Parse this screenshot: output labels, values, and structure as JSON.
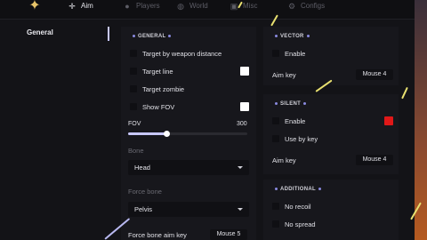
{
  "tabs": [
    {
      "label": "Aim",
      "icon": "crosshair-icon",
      "active": true
    },
    {
      "label": "Players",
      "icon": "user-icon",
      "active": false
    },
    {
      "label": "World",
      "icon": "globe-icon",
      "active": false
    },
    {
      "label": "Misc",
      "icon": "box-icon",
      "active": false
    },
    {
      "label": "Configs",
      "icon": "gear-icon",
      "active": false
    }
  ],
  "sidebar": {
    "items": [
      {
        "label": "General",
        "active": true
      }
    ]
  },
  "general": {
    "title": "GENERAL",
    "options": [
      {
        "label": "Target by weapon distance",
        "checked": false
      },
      {
        "label": "Target line",
        "checked": false,
        "color": "#ffffff"
      },
      {
        "label": "Target zombie",
        "checked": false
      },
      {
        "label": "Show FOV",
        "checked": false,
        "color": "#ffffff"
      }
    ],
    "fov": {
      "label": "FOV",
      "value": "300",
      "fraction": 0.32
    },
    "bone": {
      "label": "Bone",
      "value": "Head"
    },
    "force_bone": {
      "label": "Force bone",
      "value": "Pelvis"
    },
    "force_bone_aim_key": {
      "label": "Force bone aim key",
      "value": "Mouse 5"
    }
  },
  "vector": {
    "title": "VECTOR",
    "enable": {
      "label": "Enable",
      "checked": false
    },
    "aim_key": {
      "label": "Aim key",
      "value": "Mouse 4"
    }
  },
  "silent": {
    "title": "SILENT",
    "enable": {
      "label": "Enable",
      "checked": false,
      "color": "#e01818"
    },
    "use_by_key": {
      "label": "Use by key",
      "checked": false
    },
    "aim_key": {
      "label": "Aim key",
      "value": "Mouse 4"
    }
  },
  "additional": {
    "title": "ADDITIONAL",
    "options": [
      {
        "label": "No recoil",
        "checked": false
      },
      {
        "label": "No spread",
        "checked": false
      }
    ]
  },
  "colors": {
    "accent": "#c8c8ff",
    "logo": "#e8c56a",
    "panel": "#17171c",
    "window": "#131317"
  }
}
